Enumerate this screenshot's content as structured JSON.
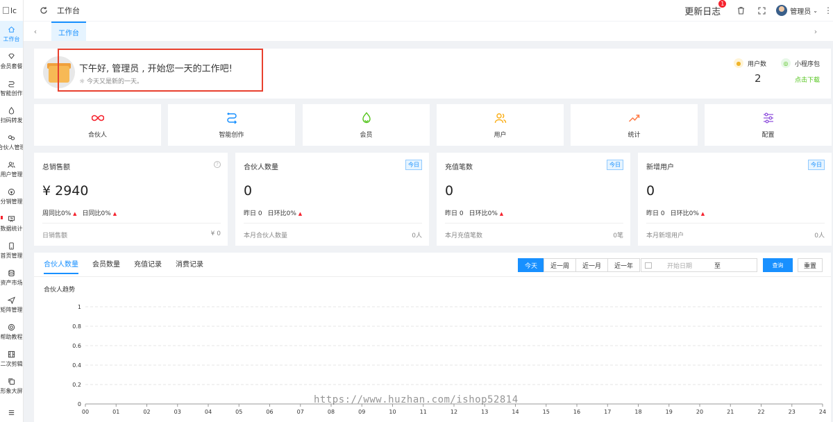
{
  "sidebar": {
    "logo_text": "lc",
    "items": [
      {
        "label": "工作台",
        "icon": "home-icon",
        "active": true
      },
      {
        "label": "会员套餐",
        "icon": "diamond-icon"
      },
      {
        "label": "智能创作",
        "icon": "route-icon"
      },
      {
        "label": "扫码转发",
        "icon": "flame-icon"
      },
      {
        "label": "合伙人管理",
        "icon": "link-icon"
      },
      {
        "label": "用户管理",
        "icon": "users-icon"
      },
      {
        "label": "分销管理",
        "icon": "coin-icon"
      },
      {
        "label": "数据统计",
        "icon": "presentation-icon"
      },
      {
        "label": "首页管理",
        "icon": "mobile-icon"
      },
      {
        "label": "资产市场",
        "icon": "database-icon"
      },
      {
        "label": "矩阵管理",
        "icon": "send-icon"
      },
      {
        "label": "帮助教程",
        "icon": "help-ring-icon"
      },
      {
        "label": "二次剪辑",
        "icon": "film-icon"
      },
      {
        "label": "形象大屏",
        "icon": "copy-icon"
      },
      {
        "label": "",
        "icon": "list-icon"
      }
    ]
  },
  "header": {
    "breadcrumb": "工作台",
    "changelog_label": "更新日志",
    "changelog_badge": "1",
    "username": "管理员"
  },
  "tabs": {
    "items": [
      "工作台"
    ]
  },
  "welcome": {
    "greeting": "下午好, 管理员 , 开始您一天的工作吧!",
    "subtitle": "今天又是新的一天。",
    "user_count_label": "用户数",
    "user_count_value": "2",
    "miniprogram_label": "小程序包",
    "miniprogram_link": "点击下载"
  },
  "shortcuts": [
    {
      "label": "合伙人",
      "icon": "infinity-icon",
      "color": "#f5222d"
    },
    {
      "label": "智能创作",
      "icon": "route-icon",
      "color": "#1890ff"
    },
    {
      "label": "会员",
      "icon": "flame-icon",
      "color": "#52c41a"
    },
    {
      "label": "用户",
      "icon": "users-icon",
      "color": "#faad14"
    },
    {
      "label": "统计",
      "icon": "trend-icon",
      "color": "#ff7a45"
    },
    {
      "label": "配置",
      "icon": "sliders-icon",
      "color": "#9254de"
    }
  ],
  "cards": [
    {
      "title": "总销售额",
      "value": "¥ 2940",
      "compare": [
        "周同比0%",
        "日同比0%"
      ],
      "footer_label": "日销售额",
      "footer_value": "¥ 0",
      "tag": "",
      "help": true
    },
    {
      "title": "合伙人数量",
      "value": "0",
      "compare": [
        "昨日 0",
        "日环比0%"
      ],
      "footer_label": "本月合伙人数量",
      "footer_value": "0人",
      "tag": "今日",
      "help": false
    },
    {
      "title": "充值笔数",
      "value": "0",
      "compare": [
        "昨日 0",
        "日环比0%"
      ],
      "footer_label": "本月充值笔数",
      "footer_value": "0笔",
      "tag": "今日",
      "help": false
    },
    {
      "title": "新增用户",
      "value": "0",
      "compare": [
        "昨日 0",
        "日环比0%"
      ],
      "footer_label": "本月新增用户",
      "footer_value": "0人",
      "tag": "今日",
      "help": false
    }
  ],
  "panel": {
    "tabs": [
      "合伙人数量",
      "会员数量",
      "充值记录",
      "消费记录"
    ],
    "active_tab": 0,
    "ranges": [
      "今天",
      "近一周",
      "近一月",
      "近一年"
    ],
    "active_range": 0,
    "date_start_placeholder": "开始日期",
    "date_separator": "至",
    "query_label": "查询",
    "reset_label": "重置",
    "chart_title": "合伙人趋势"
  },
  "chart_data": {
    "type": "line",
    "title": "合伙人趋势",
    "x": [
      "00",
      "01",
      "02",
      "03",
      "04",
      "05",
      "06",
      "07",
      "08",
      "09",
      "10",
      "11",
      "12",
      "13",
      "14",
      "15",
      "16",
      "17",
      "18",
      "19",
      "20",
      "21",
      "22",
      "23",
      "24"
    ],
    "yticks": [
      0,
      0.2,
      0.4,
      0.6,
      0.8,
      1
    ],
    "ylim": [
      0,
      1
    ],
    "series": [],
    "grid": true
  },
  "watermark": "https://www.huzhan.com/ishop52814",
  "colors": {
    "accent": "#1890ff",
    "danger": "#f5222d",
    "success": "#52c41a",
    "highlight_box": "#e8402e"
  }
}
